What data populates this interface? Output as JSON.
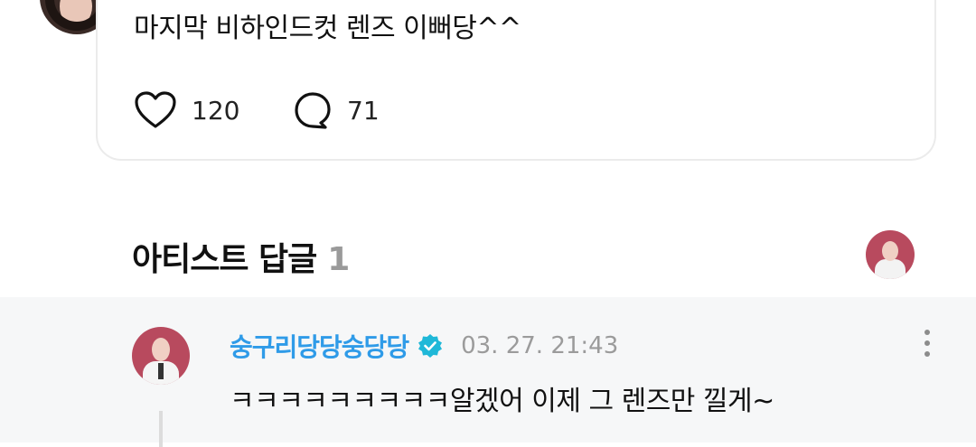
{
  "post": {
    "text": "마지막 비하인드컷 렌즈 이뻐당^^",
    "likes": "120",
    "replies": "71"
  },
  "artist_replies": {
    "title": "아티스트 답글",
    "count": "1"
  },
  "reply": {
    "author": "숭구리당당숭당당",
    "timestamp": "03. 27. 21:43",
    "text": "ㅋㅋㅋㅋㅋㅋㅋㅋㅋ알겠어 이제 그 렌즈만 낄게~"
  },
  "colors": {
    "accent_name": "#2f9be8",
    "verified_badge": "#1fb8d8",
    "reply_background": "#f6f7f8"
  },
  "icons": [
    "heart-icon",
    "speech-bubble-icon",
    "verified-badge-icon",
    "more-vertical-icon"
  ]
}
